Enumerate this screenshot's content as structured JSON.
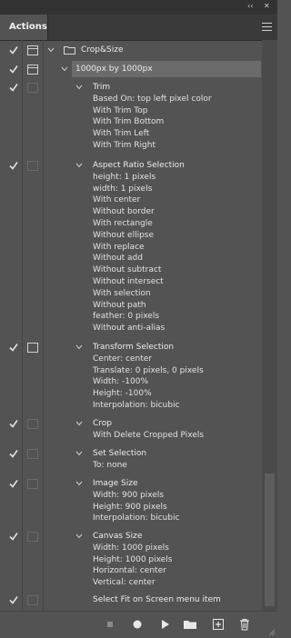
{
  "panel": {
    "tab_label": "Actions",
    "collapse_glyph": "‹‹",
    "close_glyph": "✕"
  },
  "actions": {
    "set_name": "Crop&Size",
    "action_name": "1000px by 1000px",
    "steps": [
      {
        "label": "Trim",
        "params": [
          "Based On: top left pixel color",
          "With Trim Top",
          "With Trim Bottom",
          "With Trim Left",
          "With Trim Right"
        ]
      },
      {
        "label": "Aspect Ratio Selection",
        "params": [
          "height: 1 pixels",
          "width: 1 pixels",
          "With center",
          "Without border",
          "With rectangle",
          "Without ellipse",
          "With replace",
          "Without add",
          "Without subtract",
          "Without intersect",
          "With selection",
          "Without path",
          "feather: 0 pixels",
          "Without anti-alias"
        ]
      },
      {
        "label": "Transform Selection",
        "params": [
          "Center: center",
          "Translate: 0 pixels, 0 pixels",
          "Width: -100%",
          "Height: -100%",
          "Interpolation: bicubic"
        ]
      },
      {
        "label": "Crop",
        "params": [
          "With Delete Cropped Pixels"
        ]
      },
      {
        "label": "Set Selection",
        "params": [
          "To: none"
        ]
      },
      {
        "label": "Image Size",
        "params": [
          "Width: 900 pixels",
          "Height: 900 pixels",
          "Interpolation: bicubic"
        ]
      },
      {
        "label": "Canvas Size",
        "params": [
          "Width: 1000 pixels",
          "Height: 1000 pixels",
          "Horizontal: center",
          "Vertical: center"
        ]
      },
      {
        "label": "Select Fit on Screen menu item",
        "params": []
      }
    ]
  },
  "toolbar": {
    "buttons": [
      "stop-icon",
      "record-icon",
      "play-icon",
      "new-set-folder-icon",
      "new-action-icon",
      "delete-icon"
    ]
  },
  "colors": {
    "panel_bg": "#535353",
    "highlight_row": "#6b6b6b",
    "text": "#ececec"
  }
}
